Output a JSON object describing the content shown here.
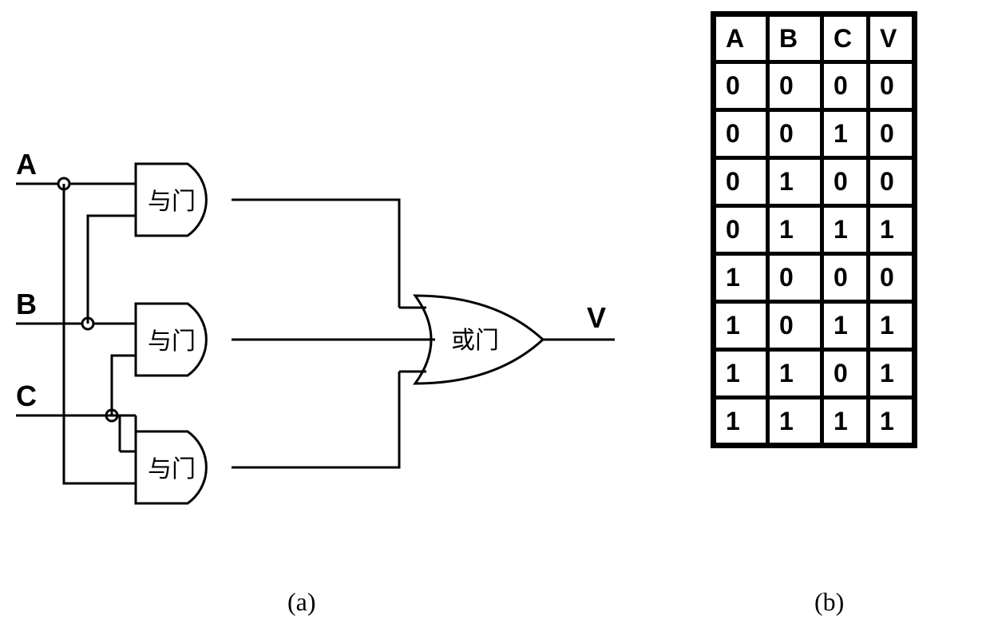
{
  "circuit": {
    "inputs": {
      "A": "A",
      "B": "B",
      "C": "C"
    },
    "output": "V",
    "gates": {
      "and1": "与门",
      "and2": "与门",
      "and3": "与门",
      "or": "或门"
    }
  },
  "subfig_labels": {
    "a": "(a)",
    "b": "(b)"
  },
  "chart_data": {
    "type": "table",
    "title": "",
    "columns": [
      "A",
      "B",
      "C",
      "V"
    ],
    "rows": [
      {
        "A": "0",
        "B": "0",
        "C": "0",
        "V": "0"
      },
      {
        "A": "0",
        "B": "0",
        "C": "1",
        "V": "0"
      },
      {
        "A": "0",
        "B": "1",
        "C": "0",
        "V": "0"
      },
      {
        "A": "0",
        "B": "1",
        "C": "1",
        "V": "1"
      },
      {
        "A": "1",
        "B": "0",
        "C": "0",
        "V": "0"
      },
      {
        "A": "1",
        "B": "0",
        "C": "1",
        "V": "1"
      },
      {
        "A": "1",
        "B": "1",
        "C": "0",
        "V": "1"
      },
      {
        "A": "1",
        "B": "1",
        "C": "1",
        "V": "1"
      }
    ]
  }
}
